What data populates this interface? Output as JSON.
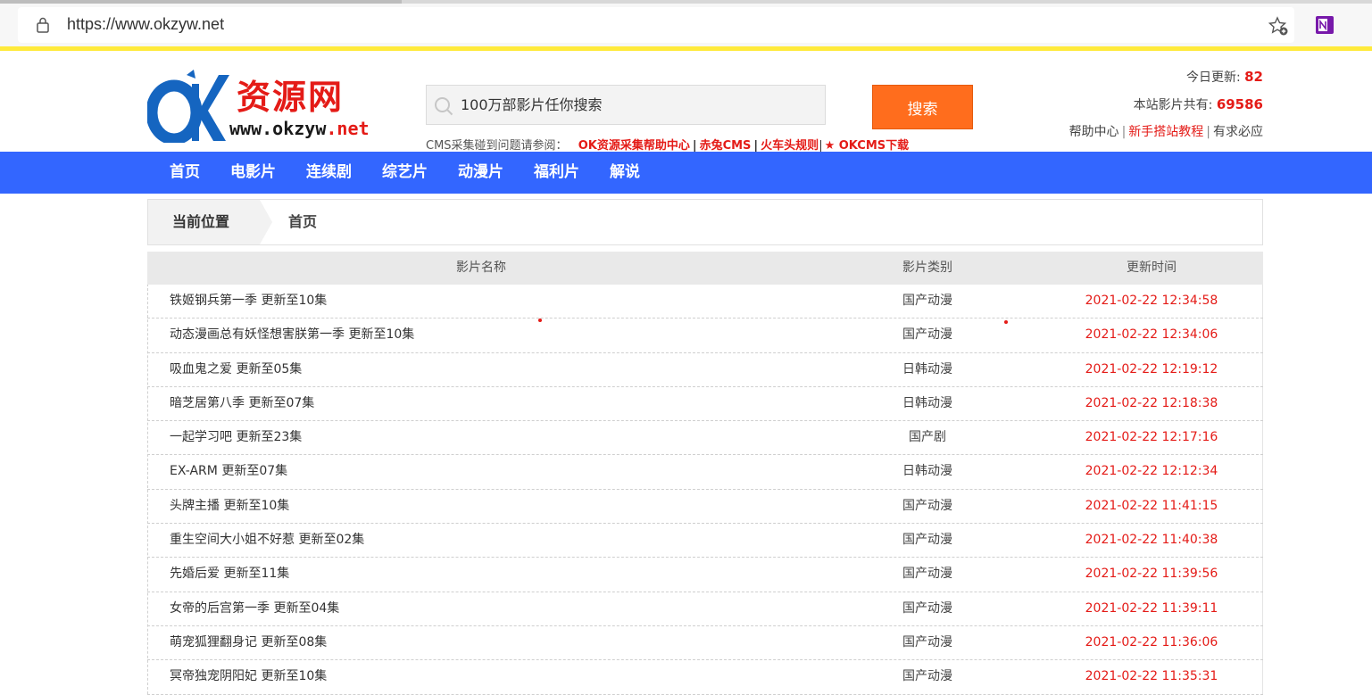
{
  "browser": {
    "url": "https://www.okzyw.net"
  },
  "header": {
    "logo_cn": "资源网",
    "logo_url_main": "www.okzyw",
    "logo_url_net": ".net",
    "search_placeholder": "100万部影片任你搜索",
    "search_button": "搜索",
    "cms_prefix": "CMS采集碰到问题请参阅：",
    "cms_links": [
      "OK资源采集帮助中心",
      "赤兔CMS",
      "火车头规则",
      "★ OKCMS下载"
    ],
    "cms_separators": [
      "|",
      "|",
      "|"
    ],
    "stats": {
      "today_label": "今日更新:",
      "today_value": "82",
      "total_label": "本站影片共有:",
      "total_value": "69586"
    },
    "links": [
      "帮助中心",
      "新手搭站教程",
      "有求必应"
    ],
    "link_separators": [
      "|",
      "|"
    ]
  },
  "nav": [
    "首页",
    "电影片",
    "连续剧",
    "综艺片",
    "动漫片",
    "福利片",
    "解说"
  ],
  "breadcrumb": {
    "label": "当前位置",
    "current": "首页"
  },
  "table": {
    "headers": [
      "影片名称",
      "影片类别",
      "更新时间"
    ],
    "rows": [
      {
        "name": "铁姬钢兵第一季 更新至10集",
        "type": "国产动漫",
        "time": "2021-02-22 12:34:58"
      },
      {
        "name": "动态漫画总有妖怪想害朕第一季 更新至10集",
        "type": "国产动漫",
        "time": "2021-02-22 12:34:06"
      },
      {
        "name": "吸血鬼之爱 更新至05集",
        "type": "日韩动漫",
        "time": "2021-02-22 12:19:12"
      },
      {
        "name": "暗芝居第八季 更新至07集",
        "type": "日韩动漫",
        "time": "2021-02-22 12:18:38"
      },
      {
        "name": "一起学习吧 更新至23集",
        "type": "国产剧",
        "time": "2021-02-22 12:17:16"
      },
      {
        "name": "EX-ARM 更新至07集",
        "type": "日韩动漫",
        "time": "2021-02-22 12:12:34"
      },
      {
        "name": "头牌主播 更新至10集",
        "type": "国产动漫",
        "time": "2021-02-22 11:41:15"
      },
      {
        "name": "重生空间大小姐不好惹 更新至02集",
        "type": "国产动漫",
        "time": "2021-02-22 11:40:38"
      },
      {
        "name": "先婚后爱 更新至11集",
        "type": "国产动漫",
        "time": "2021-02-22 11:39:56"
      },
      {
        "name": "女帝的后宫第一季 更新至04集",
        "type": "国产动漫",
        "time": "2021-02-22 11:39:11"
      },
      {
        "name": "萌宠狐狸翻身记 更新至08集",
        "type": "国产动漫",
        "time": "2021-02-22 11:36:06"
      },
      {
        "name": "冥帝独宠阴阳妃 更新至10集",
        "type": "国产动漫",
        "time": "2021-02-22 11:35:31"
      }
    ]
  },
  "icons": {
    "lock": "lock-icon",
    "favorite": "favorite-star-icon",
    "onenote": "onenote-icon",
    "search": "search-icon"
  },
  "colors": {
    "accent_blue": "#3366ff",
    "search_orange": "#ff6d1d",
    "brand_red": "#e41b17",
    "ticker_yellow": "#ffea3b"
  }
}
